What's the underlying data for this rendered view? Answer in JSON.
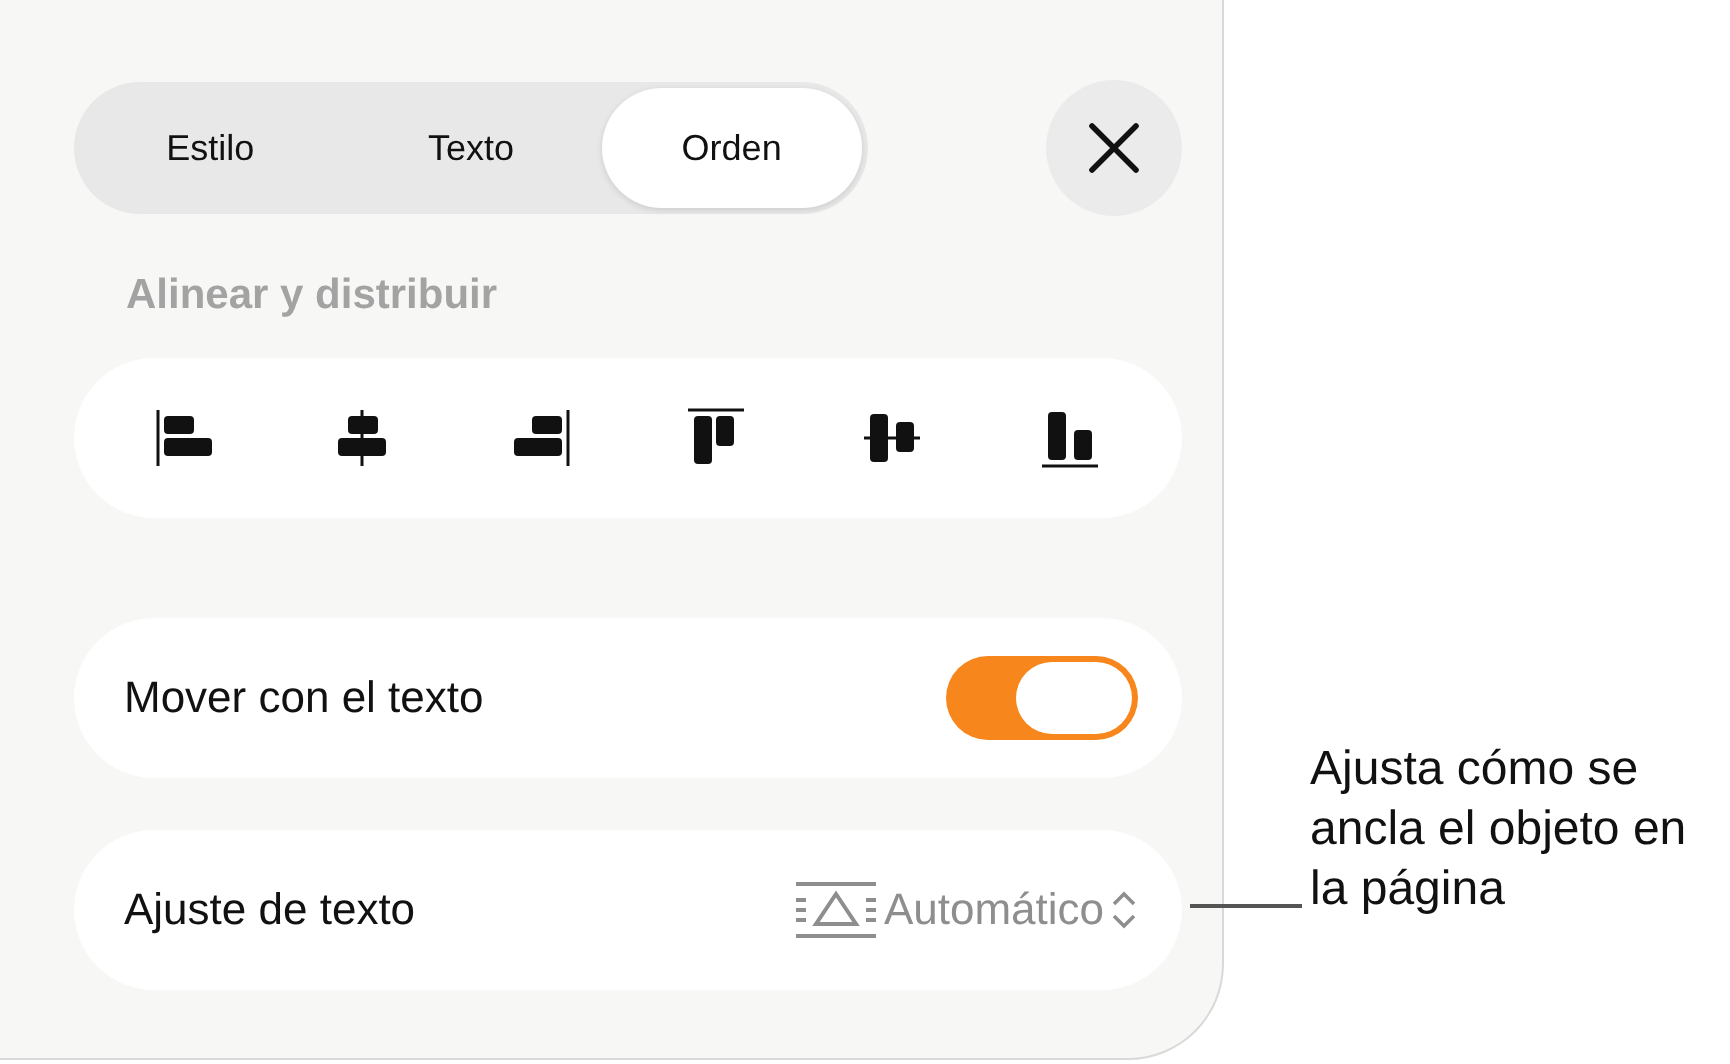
{
  "tabs": [
    {
      "label": "Estilo",
      "selected": false
    },
    {
      "label": "Texto",
      "selected": false
    },
    {
      "label": "Orden",
      "selected": true
    }
  ],
  "section_title": "Alinear y distribuir",
  "align_buttons": [
    {
      "kind": "left"
    },
    {
      "kind": "center"
    },
    {
      "kind": "right"
    },
    {
      "kind": "top"
    },
    {
      "kind": "middle"
    },
    {
      "kind": "bottom"
    }
  ],
  "move_with_text": {
    "label": "Mover con el texto",
    "on": true
  },
  "text_wrap": {
    "label": "Ajuste de texto",
    "value": "Automático"
  },
  "callout": "Ajusta cómo se ancla el objeto en la página"
}
